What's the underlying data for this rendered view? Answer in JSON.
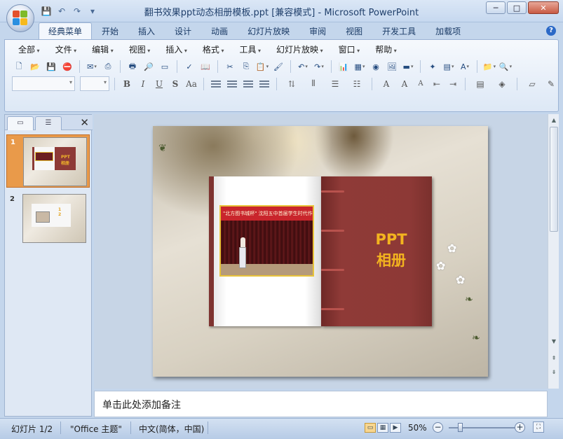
{
  "window": {
    "title": "翻书效果ppt动态相册模板.ppt [兼容模式] - Microsoft PowerPoint",
    "controls": {
      "minimize": "─",
      "maximize": "□",
      "close": "✕"
    }
  },
  "quick_access": {
    "save_icon": "💾",
    "undo_icon": "↶",
    "redo_icon": "↷",
    "more_icon": "▾"
  },
  "ribbon_tabs": [
    "经典菜单",
    "开始",
    "插入",
    "设计",
    "动画",
    "幻灯片放映",
    "审阅",
    "视图",
    "开发工具",
    "加载项"
  ],
  "active_tab": "经典菜单",
  "help": "?",
  "classic_menu": [
    "全部",
    "文件",
    "编辑",
    "视图",
    "插入",
    "格式",
    "工具",
    "幻灯片放映",
    "窗口",
    "帮助"
  ],
  "toolbar_icons": {
    "new": "🗋",
    "open": "📂",
    "save": "💾",
    "print": "🖶",
    "cut": "✂",
    "copy": "⎘",
    "paste": "📋",
    "undo": "↶",
    "redo": "↷",
    "chart": "📊",
    "table": "▦",
    "text_box": "A",
    "find": "🔍"
  },
  "format_buttons": {
    "bold": "B",
    "italic": "I",
    "underline": "U",
    "shadow": "S",
    "font_size": "Aa",
    "font_color": "A",
    "grow": "A",
    "shrink": "A"
  },
  "slides_pane": {
    "close": "✕",
    "thumbnails": [
      {
        "number": "1",
        "mini_title": "PPT\n相册"
      },
      {
        "number": "2",
        "mini_title": ""
      }
    ]
  },
  "slide": {
    "banner_text": "\"北方图书城杯\" 沈阳五中首届学生时代作品大赛",
    "title_line1": "PPT",
    "title_line2": "相册"
  },
  "notes": {
    "placeholder": "单击此处添加备注"
  },
  "status_bar": {
    "slide_position": "幻灯片 1/2",
    "theme": "\"Office 主题\"",
    "language": "中文(简体，中国)",
    "zoom": "50%",
    "zoom_minus": "−",
    "zoom_plus": "+",
    "zoom_fraction": 0.5
  },
  "colors": {
    "ribbon_blue": "#c4d6ec",
    "book_red": "#8d3936",
    "title_gold": "#f3b41f",
    "selected_thumb": "#e99a4a"
  }
}
